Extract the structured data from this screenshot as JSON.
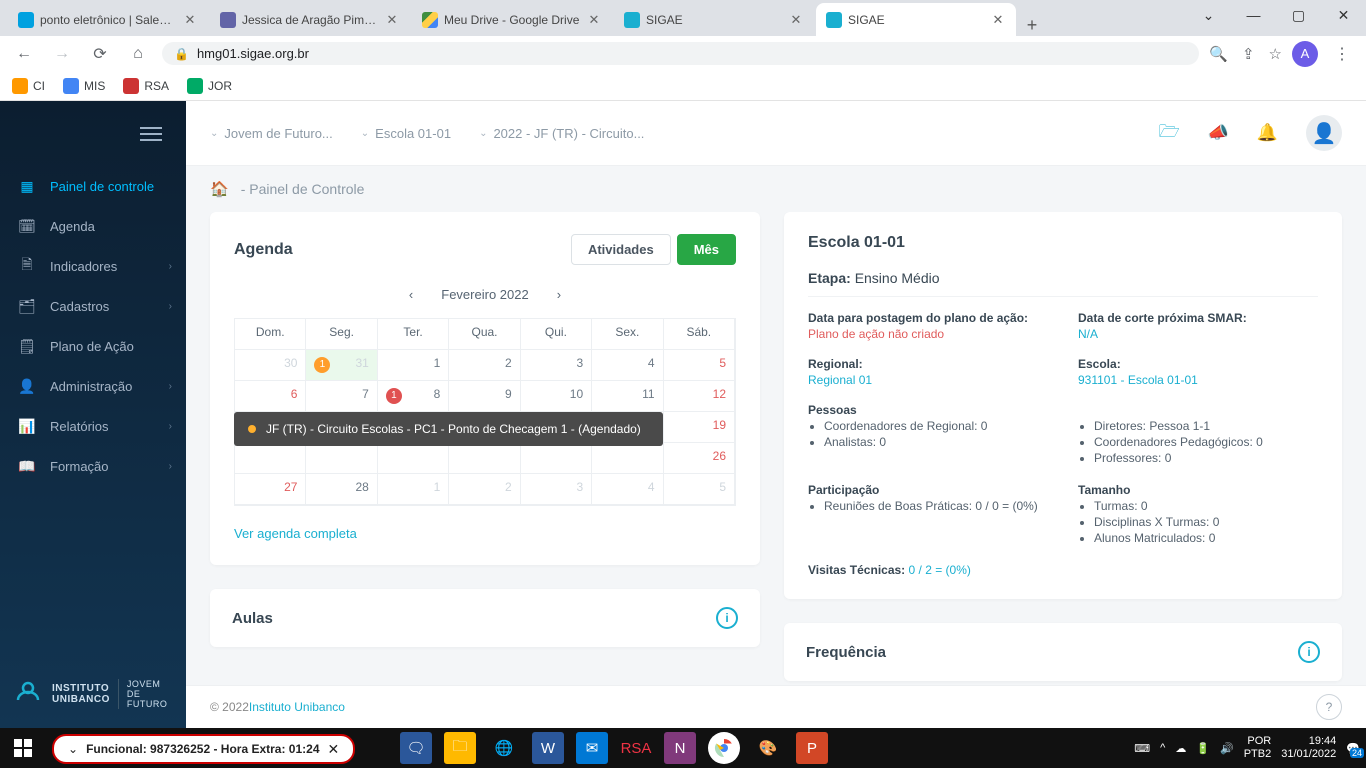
{
  "browser": {
    "tabs": [
      {
        "title": "ponto eletrônico | Salesforce",
        "favicon": "sf"
      },
      {
        "title": "Jessica de Aragão Pimenta | M",
        "favicon": "teams"
      },
      {
        "title": "Meu Drive - Google Drive",
        "favicon": "drive"
      },
      {
        "title": "SIGAE",
        "favicon": "sigae"
      },
      {
        "title": "SIGAE",
        "favicon": "sigae",
        "active": true
      }
    ],
    "url": "hmg01.sigae.org.br",
    "profile_letter": "A",
    "bookmarks": [
      "CI",
      "MIS",
      "RSA",
      "JOR"
    ]
  },
  "sidebar": {
    "items": [
      {
        "label": "Painel de controle",
        "active": true
      },
      {
        "label": "Agenda"
      },
      {
        "label": "Indicadores",
        "chev": true
      },
      {
        "label": "Cadastros",
        "chev": true
      },
      {
        "label": "Plano de Ação"
      },
      {
        "label": "Administração",
        "chev": true
      },
      {
        "label": "Relatórios",
        "chev": true
      },
      {
        "label": "Formação",
        "chev": true
      }
    ],
    "footer_brand1": "INSTITUTO",
    "footer_brand2": "UNIBANCO",
    "footer_brand3": "JOVEM DE FUTURO"
  },
  "topbar": {
    "crumb1": "Jovem de Futuro...",
    "crumb2": "Escola 01-01",
    "crumb3": "2022 - JF (TR) - Circuito..."
  },
  "page": {
    "breadcrumb": "- Painel de Controle"
  },
  "agenda": {
    "title": "Agenda",
    "btn_atividades": "Atividades",
    "btn_mes": "Mês",
    "month_label": "Fevereiro 2022",
    "dow": [
      "Dom.",
      "Seg.",
      "Ter.",
      "Qua.",
      "Qui.",
      "Sex.",
      "Sáb."
    ],
    "tooltip": "JF (TR) - Circuito Escolas - PC1 - Ponto de Checagem 1 - (Agendado)",
    "see_all": "Ver agenda completa"
  },
  "info": {
    "title": "Escola 01-01",
    "etapa_label": "Etapa:",
    "etapa_value": "Ensino Médio",
    "data_postagem_label": "Data para postagem do plano de ação:",
    "data_postagem_value": "Plano de ação não criado",
    "data_corte_label": "Data de corte próxima SMAR:",
    "data_corte_value": "N/A",
    "regional_label": "Regional:",
    "regional_value": "Regional 01",
    "escola_label": "Escola:",
    "escola_value": "931101 - Escola 01-01",
    "pessoas_label": "Pessoas",
    "pessoas_left": [
      "Coordenadores de Regional: 0",
      "Analistas: 0"
    ],
    "pessoas_right": [
      "Diretores: Pessoa 1-1",
      "Coordenadores Pedagógicos: 0",
      "Professores: 0"
    ],
    "participacao_label": "Participação",
    "participacao_items": [
      "Reuniões de Boas Práticas: 0 / 0 = (0%)"
    ],
    "tamanho_label": "Tamanho",
    "tamanho_items": [
      "Turmas: 0",
      "Disciplinas X Turmas: 0",
      "Alunos Matriculados: 0"
    ],
    "visitas_label": "Visitas Técnicas:",
    "visitas_value": "0 / 2 = (0%)"
  },
  "aulas": {
    "title": "Aulas"
  },
  "freq": {
    "title": "Frequência"
  },
  "footer": {
    "copyright": "© 2022 ",
    "link": "Instituto Unibanco"
  },
  "taskbar": {
    "pill_left_label": "Funcional: 987326252 - Hora Extra: 01:24",
    "lang1": "POR",
    "lang2": "PTB2",
    "time": "19:44",
    "date": "31/01/2022",
    "notif": "24"
  }
}
